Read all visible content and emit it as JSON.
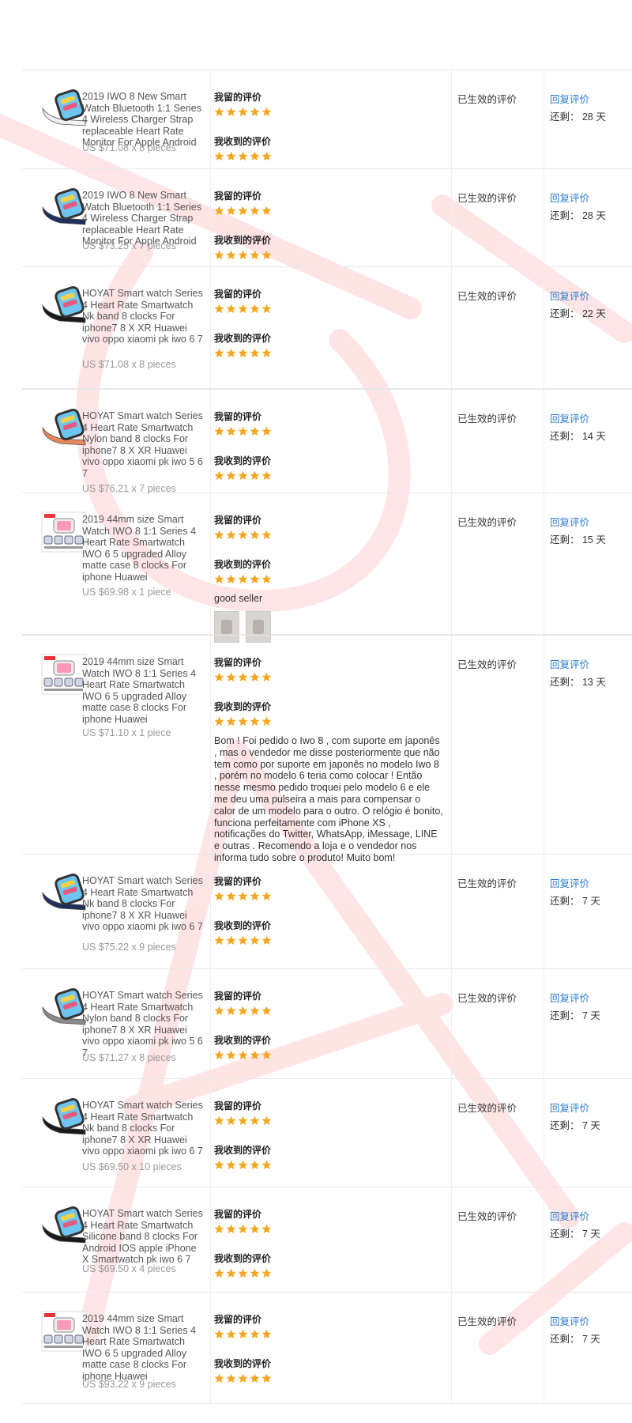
{
  "labels": {
    "my_review": "我留的评价",
    "received_review": "我收到的评价",
    "status": "已生效的评价",
    "reply": "回复评价",
    "remain_prefix": "还剩："
  },
  "colors": {
    "star": "#f5a623",
    "link": "#2a7bd3",
    "watermark": "#ffd9d9"
  },
  "rows": [
    {
      "title": "2019 IWO 8 New Smart Watch Bluetooth 1:1 Series 4 Wireless Charger Strap replaceable Heart Rate Monitor For Apple Android",
      "price": "US $71.08 x 8 pieces",
      "remain": "28 天",
      "thumb_icon": "white-watch-icon",
      "stars_mine": 5,
      "stars_received": 5
    },
    {
      "title": "2019 IWO 8 New Smart Watch Bluetooth 1:1 Series 4 Wireless Charger Strap replaceable Heart Rate Monitor For Apple Android",
      "price": "US $73.25 x 7 pieces",
      "remain": "28 天",
      "thumb_icon": "navy-watch-icon",
      "stars_mine": 5,
      "stars_received": 5
    },
    {
      "title": "HOYAT Smart watch Series 4 Heart Rate Smartwatch Nk band 8 clocks For iphone7 8 X XR Huawei vivo oppo xiaomi pk iwo 6 7",
      "price": "US $71.08 x 8 pieces",
      "remain": "22 天",
      "thumb_icon": "black-watch-icon",
      "stars_mine": 5,
      "stars_received": 5
    },
    {
      "title": "HOYAT Smart watch Series 4 Heart Rate Smartwatch Nylon band 8 clocks For iphone7 8 X XR Huawei vivo oppo xiaomi pk iwo 5 6 7",
      "price": "US $76.21 x 7 pieces",
      "remain": "14 天",
      "thumb_icon": "orange-watch-icon",
      "stars_mine": 5,
      "stars_received": 5
    },
    {
      "title": "2019 44mm size Smart Watch IWO 8 1:1 Series 4 Heart Rate Smartwatch IWO 6 5 upgraded Alloy matte case 8 clocks For iphone Huawei",
      "price": "US $69.98 x 1 piece",
      "remain": "15 天",
      "thumb_icon": "product-collage-icon",
      "stars_mine": 5,
      "stars_received": 5,
      "comment": "good seller",
      "photos": 2
    },
    {
      "title": "2019 44mm size Smart Watch IWO 8 1:1 Series 4 Heart Rate Smartwatch IWO 6 5 upgraded Alloy matte case 8 clocks For iphone Huawei",
      "price": "US $71.10 x 1 piece",
      "remain": "13 天",
      "thumb_icon": "product-collage-icon",
      "stars_mine": 5,
      "stars_received": 5,
      "comment": "Bom ! Foi pedido o Iwo 8 , com suporte em japonês , mas o vendedor me disse posteriormente que não tem como por suporte em japonês no modelo Iwo 8 , porém no modelo 6 teria como colocar ! Então nesse mesmo pedido troquei pelo modelo 6 e ele me deu uma pulseira a mais para compensar o calor de um modelo para o outro. O relógio é bonito, funciona perfeitamente com iPhone XS , notificações do Twitter, WhatsApp, iMessage, LINE e outras . Recomendo a loja e o vendedor nos informa tudo sobre o produto! Muito bom!"
    },
    {
      "title": "HOYAT Smart watch Series 4 Heart Rate Smartwatch Nk band 8 clocks For iphone7 8 X XR Huawei vivo oppo xiaomi pk iwo 6 7",
      "price": "US $75.22 x 9 pieces",
      "remain": "7 天",
      "thumb_icon": "navy-watch-icon",
      "stars_mine": 5,
      "stars_received": 5
    },
    {
      "title": "HOYAT Smart watch Series 4 Heart Rate Smartwatch Nylon band 8 clocks For iphone7 8 X XR Huawei vivo oppo xiaomi pk iwo 5 6 7",
      "price": "US $71.27 x 8 pieces",
      "remain": "7 天",
      "thumb_icon": "grey-watch-icon",
      "stars_mine": 5,
      "stars_received": 5
    },
    {
      "title": "HOYAT Smart watch Series 4 Heart Rate Smartwatch Nk band 8 clocks For iphone7 8 X XR Huawei vivo oppo xiaomi pk iwo 6 7",
      "price": "US $69.50 x 10 pieces",
      "remain": "7 天",
      "thumb_icon": "black-watch-icon",
      "stars_mine": 5,
      "stars_received": 5
    },
    {
      "title": "HOYAT Smart watch Series 4 Heart Rate Smartwatch Silicone band 8 clocks For Android IOS apple iPhone X Smartwatch pk iwo 6 7",
      "price": "US $69.50 x 4 pieces",
      "remain": "7 天",
      "thumb_icon": "black-watch-icon",
      "stars_mine": 5,
      "stars_received": 5
    },
    {
      "title": "2019 44mm size Smart Watch IWO 8 1:1 Series 4 Heart Rate Smartwatch IWO 6 5 upgraded Alloy matte case 8 clocks For iphone Huawei",
      "price": "US $93.22 x 9 pieces",
      "remain": "7 天",
      "thumb_icon": "product-collage-icon",
      "stars_mine": 5,
      "stars_received": 5
    }
  ]
}
